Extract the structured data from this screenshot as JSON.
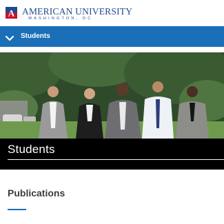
{
  "colors": {
    "brand_red": "#c8102e",
    "brand_blue": "#1f4a8c",
    "nav_blue": "#1a6fb8",
    "accent_underline": "#1a6fb8",
    "caption_bg": "#000000"
  },
  "header": {
    "logo_icon": "au-monogram-icon",
    "university_name": "AMERICAN UNIVERSITY",
    "location": "WASHINGTON, DC"
  },
  "section_nav": {
    "icon": "chevron-down-icon",
    "label": "Students"
  },
  "hero": {
    "title": "Students"
  },
  "content": {
    "section_heading": "Publications"
  }
}
